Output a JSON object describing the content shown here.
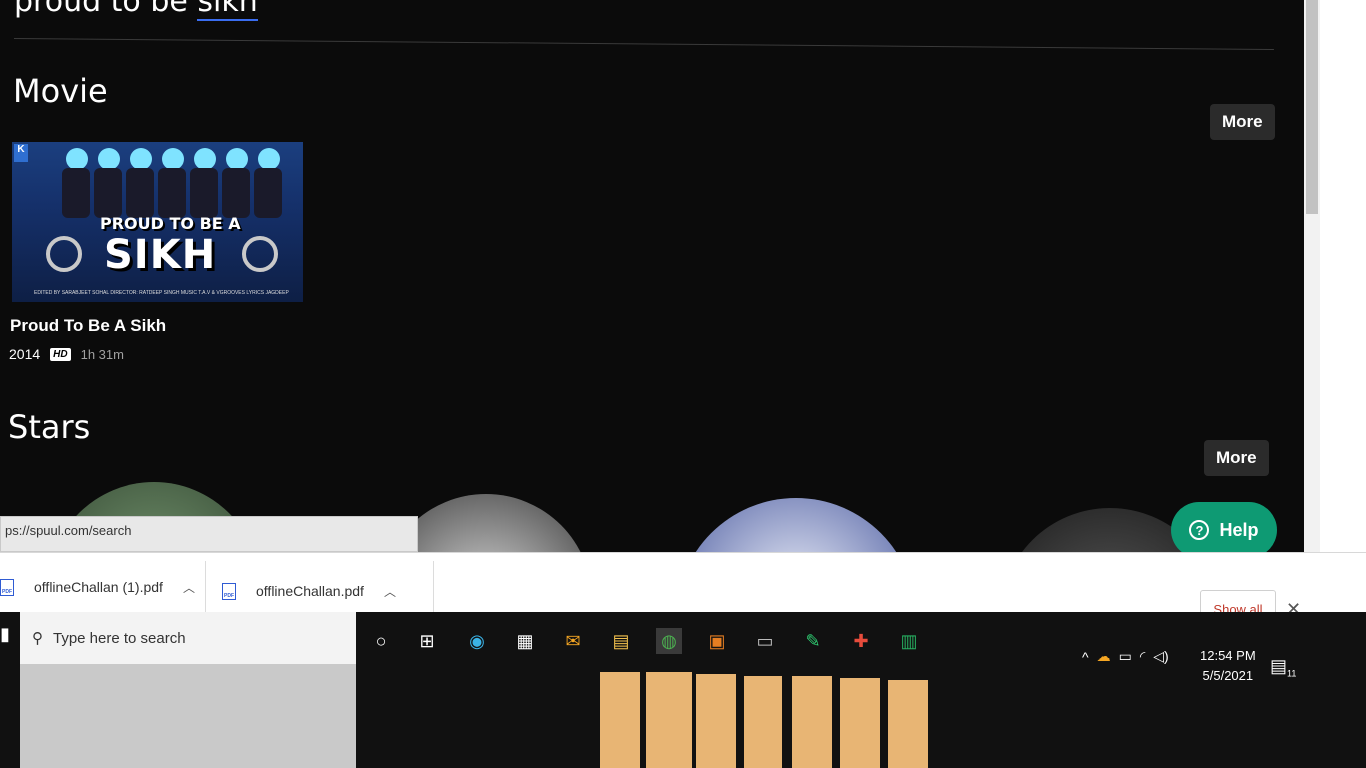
{
  "search": {
    "query_prefix": "proud to be ",
    "query_highlight": "sikh"
  },
  "movie_section": {
    "title": "Movie",
    "more_label": "More",
    "items": [
      {
        "title": "Proud To Be A Sikh",
        "year": "2014",
        "badge": "HD",
        "duration": "1h 31m",
        "poster_line1": "PROUD TO BE A",
        "poster_line2": "SIKH",
        "poster_logo": "K",
        "poster_credits": "EDITED BY SARABJEET SOHAL   DIRECTOR: RATDEEP SINGH   MUSIC T.A.V & VGROOVES   LYRICS JAGDEEP"
      }
    ]
  },
  "stars_section": {
    "title": "Stars",
    "more_label": "More"
  },
  "help_button": {
    "label": "Help",
    "icon": "?"
  },
  "status_url": "ps://spuul.com/search",
  "downloads": {
    "items": [
      {
        "name": "offlineChallan (1).pdf",
        "icon": "pdf-icon"
      },
      {
        "name": "offlineChallan.pdf",
        "icon": "pdf-icon"
      }
    ],
    "show_all_label": "Show all",
    "close_label": "✕"
  },
  "taskbar": {
    "search_placeholder": "Type here to search",
    "pinned": [
      "cortana-icon",
      "task-view-icon",
      "edge-icon",
      "store-icon",
      "mail-icon",
      "file-explorer-icon",
      "chrome-icon",
      "outlook-icon",
      "terminal-icon",
      "notepad-icon",
      "teams-icon",
      "excel-icon"
    ],
    "clock_time": "12:54 PM",
    "clock_date": "5/5/2021",
    "notification_count": "11"
  },
  "colors": {
    "accent_green": "#0e9a73",
    "page_bg": "#0b0b0b",
    "download_red": "#c0392b"
  }
}
